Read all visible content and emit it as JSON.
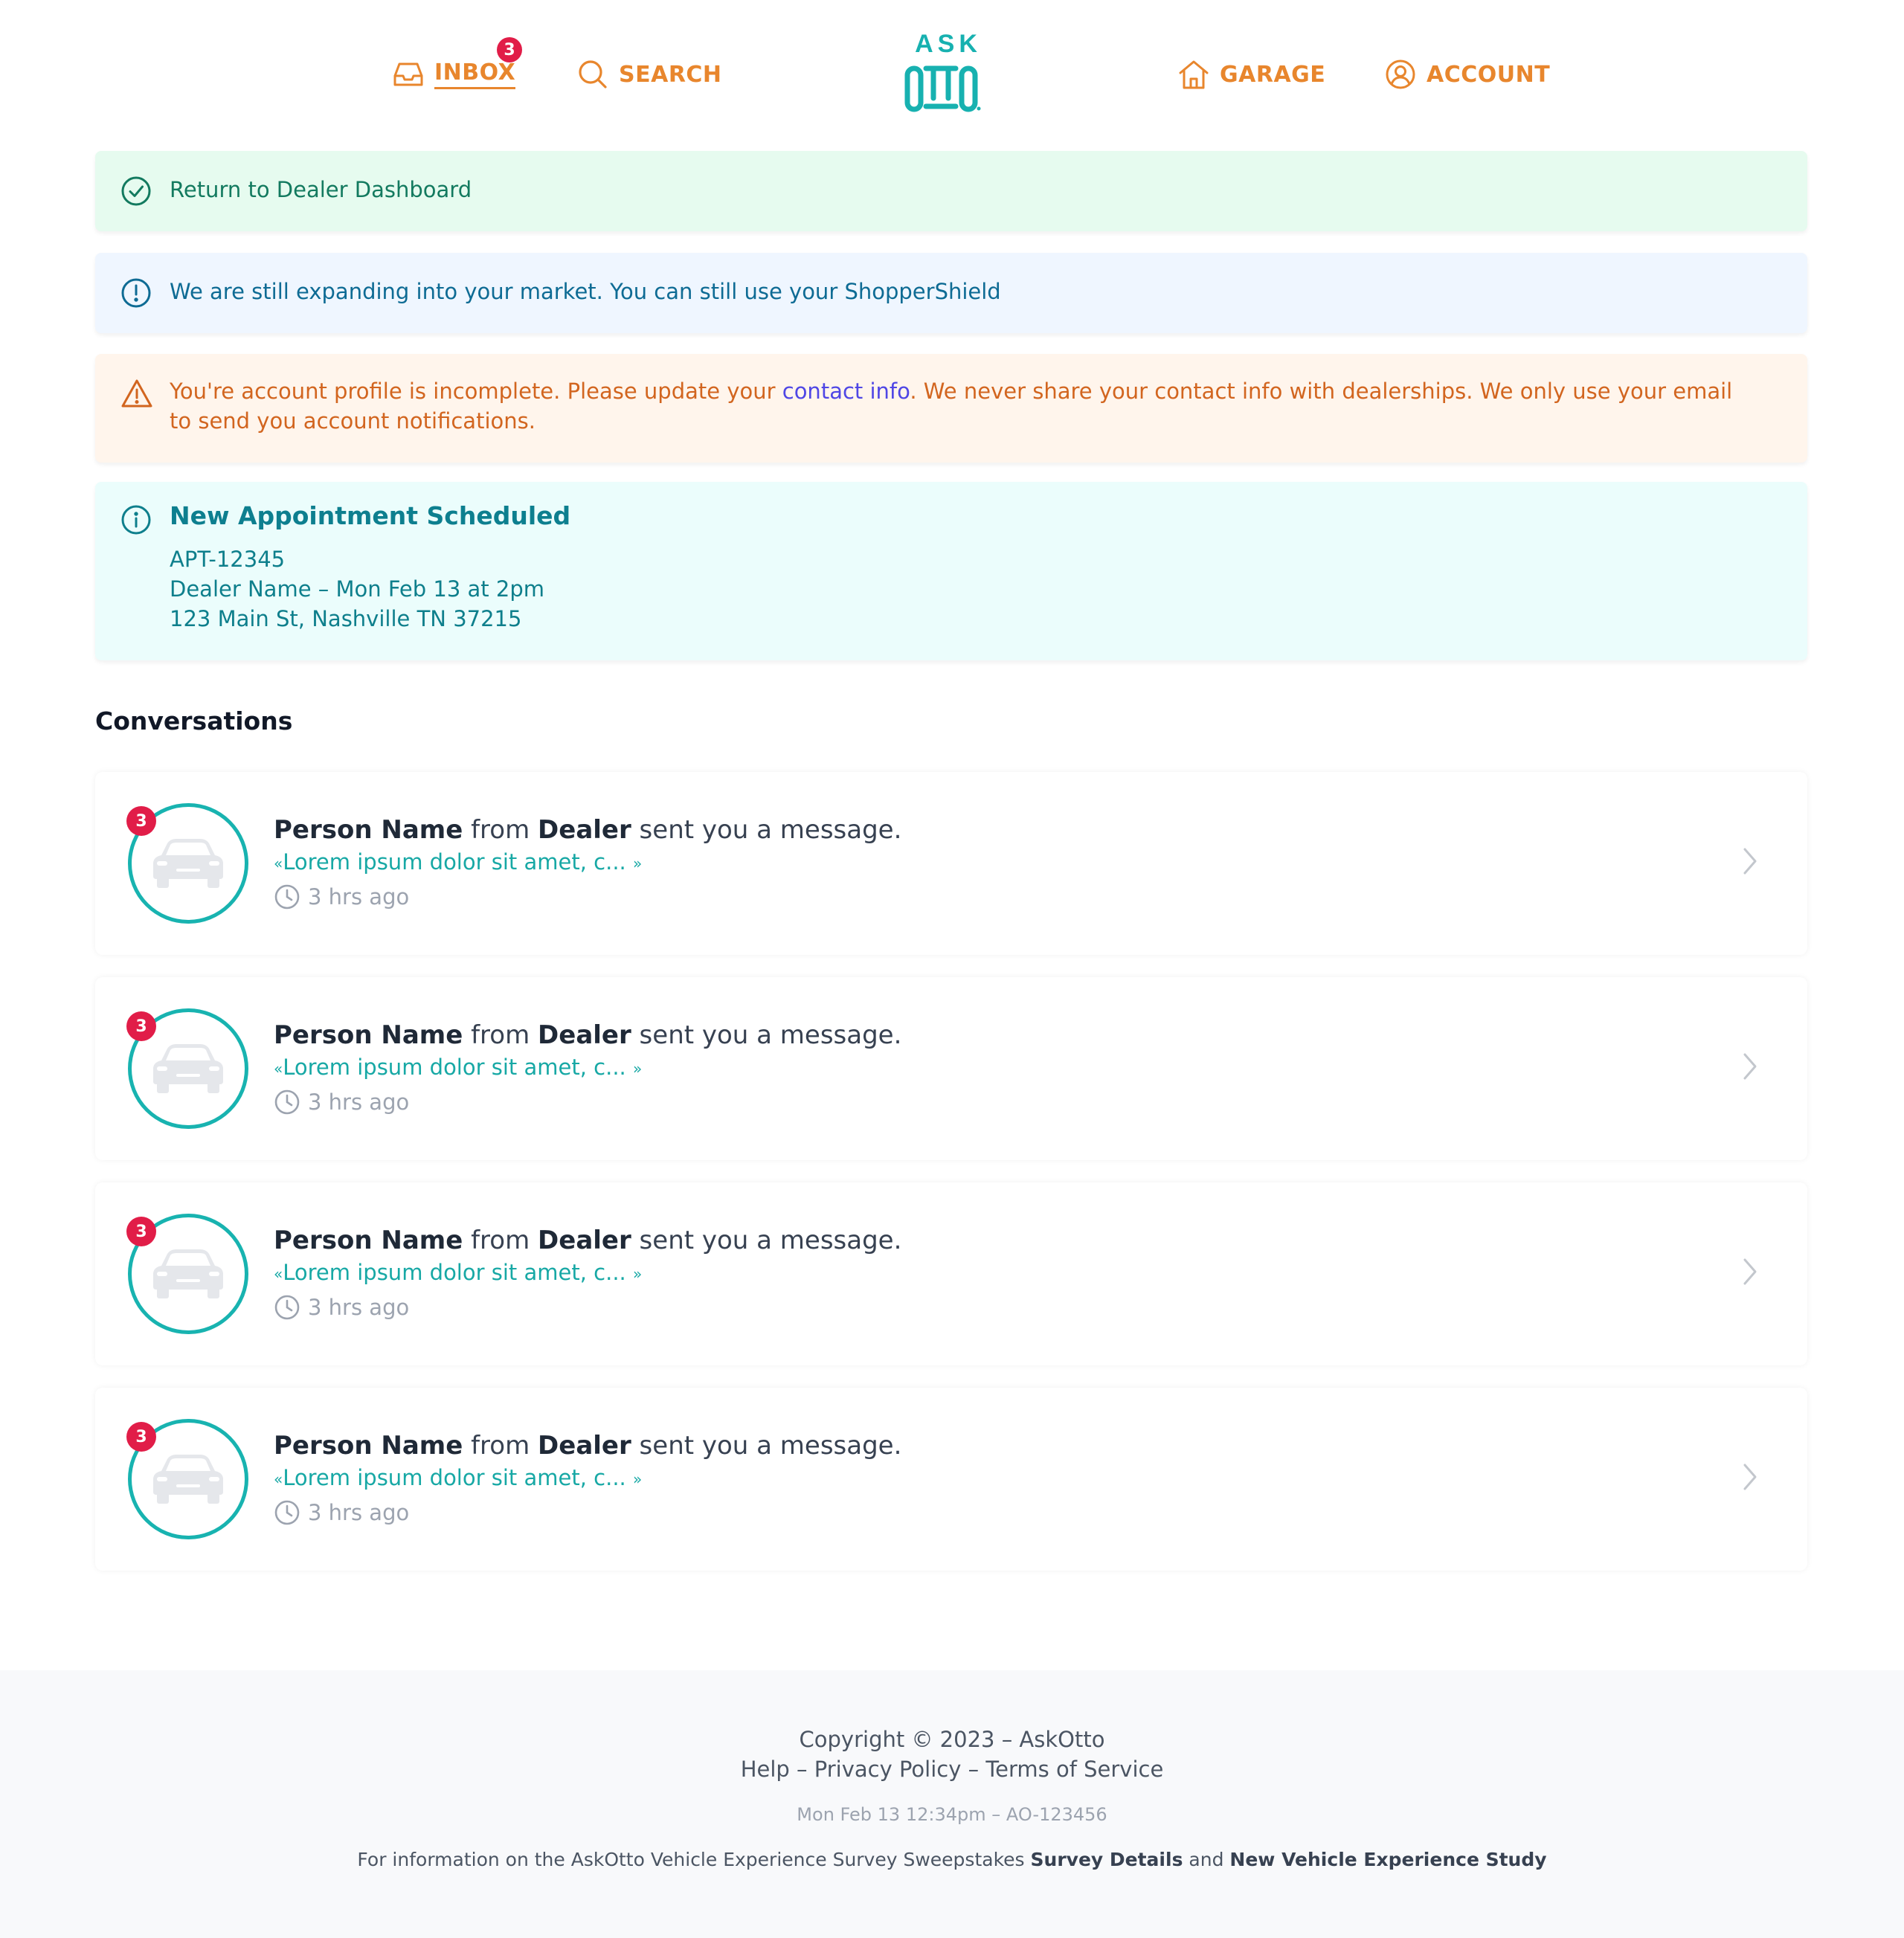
{
  "nav": {
    "inbox_label": "INBOX",
    "inbox_badge": "3",
    "search_label": "SEARCH",
    "garage_label": "GARAGE",
    "account_label": "ACCOUNT",
    "logo_top": "ASK",
    "logo_bottom": "OTTO"
  },
  "colors": {
    "accent": "#e8862d",
    "teal": "#18b3b0",
    "badge": "#e11d48",
    "link": "#4f46e5"
  },
  "alerts": {
    "success": {
      "text": "Return to Dealer Dashboard",
      "icon": "check-circle-icon"
    },
    "info": {
      "text": "We are still expanding into your market. You can still use your ShopperShield",
      "icon": "exclamation-circle-icon"
    },
    "warning": {
      "text_before": "You're account profile is incomplete. Please update your ",
      "link": "contact info",
      "text_after": ". We never share your contact info with dealerships. We only use your email to send you account notifications.",
      "icon": "warning-triangle-icon"
    },
    "appointment": {
      "title": "New Appointment Scheduled",
      "id": "APT-12345",
      "dealer_time": "Dealer Name – Mon Feb 13 at 2pm",
      "address": "123 Main St, Nashville TN 37215",
      "icon": "info-circle-icon"
    }
  },
  "conversations": {
    "title": "Conversations",
    "items": [
      {
        "badge": "3",
        "person": "Person Name",
        "from": " from ",
        "dealer": "Dealer",
        "action": " sent you a message.",
        "open_quote": "«",
        "preview": "Lorem ipsum dolor sit amet, c...",
        "close_quote": "»",
        "time": "3 hrs ago"
      },
      {
        "badge": "3",
        "person": "Person Name",
        "from": " from ",
        "dealer": "Dealer",
        "action": " sent you a message.",
        "open_quote": "«",
        "preview": "Lorem ipsum dolor sit amet, c...",
        "close_quote": "»",
        "time": "3 hrs ago"
      },
      {
        "badge": "3",
        "person": "Person Name",
        "from": " from ",
        "dealer": "Dealer",
        "action": " sent you a message.",
        "open_quote": "«",
        "preview": "Lorem ipsum dolor sit amet, c...",
        "close_quote": "»",
        "time": "3 hrs ago"
      },
      {
        "badge": "3",
        "person": "Person Name",
        "from": " from ",
        "dealer": "Dealer",
        "action": " sent you a message.",
        "open_quote": "«",
        "preview": "Lorem ipsum dolor sit amet, c...",
        "close_quote": "»",
        "time": "3 hrs ago"
      }
    ]
  },
  "footer": {
    "copyright": "Copyright © 2023 – AskOtto",
    "help": "Help",
    "sep1": " – ",
    "privacy": "Privacy Policy",
    "sep2": " – ",
    "terms": "Terms of Service",
    "stamp": "Mon Feb 13 12:34pm – AO-123456",
    "info_text": "For information on the AskOtto Vehicle Experience Survey Sweepstakes ",
    "survey_link": "Survey Details",
    "and": " and ",
    "study_link": "New Vehicle Experience Study"
  }
}
